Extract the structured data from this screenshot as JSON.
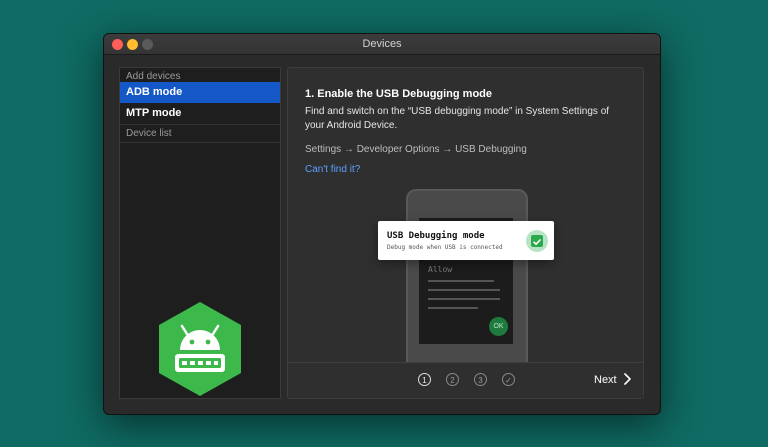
{
  "window": {
    "title": "Devices"
  },
  "sidebar": {
    "section_add": "Add devices",
    "items": [
      {
        "label": "ADB mode",
        "selected": true
      },
      {
        "label": "MTP mode",
        "selected": false
      }
    ],
    "section_list": "Device list"
  },
  "main": {
    "heading": "1. Enable the USB Debugging mode",
    "description": "Find and switch on the “USB debugging mode” in System Settings of your Android Device.",
    "path": "Settings → Developer Options → USB Debugging",
    "link": "Can't find it?",
    "phone": {
      "allow": "Allow",
      "ok": "OK"
    },
    "toast": {
      "title": "USB Debugging mode",
      "subtitle": "Debug mode when USB is connected",
      "checked": true
    }
  },
  "footer": {
    "steps": [
      "1",
      "2",
      "3",
      "✓"
    ],
    "current_step": 1,
    "next_label": "Next"
  },
  "colors": {
    "background": "#0f6b63",
    "selection": "#1458c8",
    "link": "#5aa0ff",
    "android_green": "#3db84a"
  }
}
